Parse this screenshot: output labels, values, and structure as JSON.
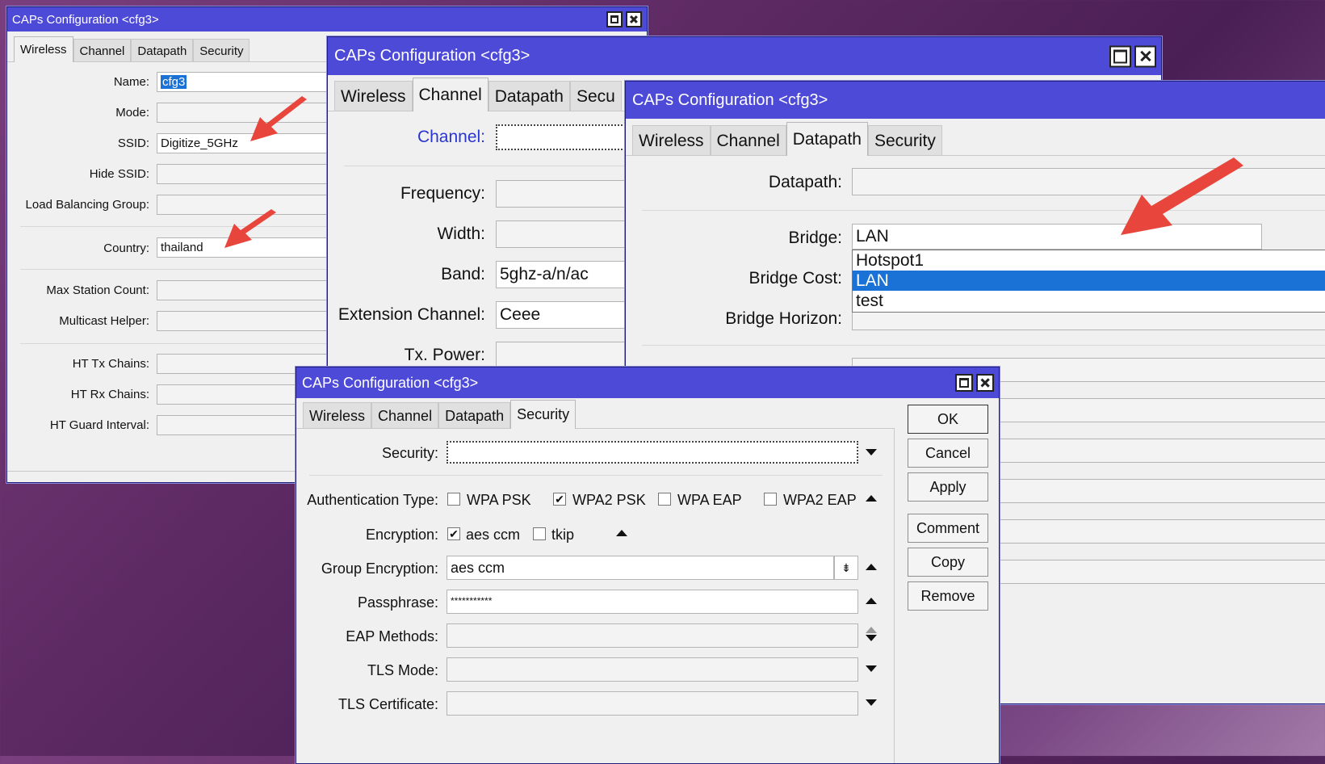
{
  "window_title": "CAPs Configuration <cfg3>",
  "tabs": [
    "Wireless",
    "Channel",
    "Datapath",
    "Security"
  ],
  "tab_truncated": "Secu",
  "wireless": {
    "name_label": "Name:",
    "name_value": "cfg3",
    "mode_label": "Mode:",
    "ssid_label": "SSID:",
    "ssid_value": "Digitize_5GHz",
    "hide_ssid_label": "Hide SSID:",
    "lbg_label": "Load Balancing Group:",
    "country_label": "Country:",
    "country_value": "thailand",
    "max_station_label": "Max Station Count:",
    "multicast_label": "Multicast Helper:",
    "ht_tx_label": "HT Tx Chains:",
    "ht_rx_label": "HT Rx Chains:",
    "ht_guard_label": "HT Guard Interval:"
  },
  "channel": {
    "channel_label": "Channel:",
    "frequency_label": "Frequency:",
    "width_label": "Width:",
    "band_label": "Band:",
    "band_value": "5ghz-a/n/ac",
    "ext_label": "Extension Channel:",
    "ext_value": "Ceee",
    "tx_power_label": "Tx. Power:"
  },
  "datapath": {
    "datapath_label": "Datapath:",
    "bridge_label": "Bridge:",
    "bridge_value": "LAN",
    "bridge_cost_label": "Bridge Cost:",
    "bridge_horizon_label": "Bridge Horizon:",
    "bridge_options": [
      "Hotspot1",
      "LAN",
      "test"
    ],
    "bridge_selected": "LAN"
  },
  "security": {
    "security_label": "Security:",
    "auth_label": "Authentication Type:",
    "auth_options": [
      {
        "label": "WPA PSK",
        "checked": false
      },
      {
        "label": "WPA2 PSK",
        "checked": true
      },
      {
        "label": "WPA EAP",
        "checked": false
      },
      {
        "label": "WPA2 EAP",
        "checked": false
      }
    ],
    "enc_label": "Encryption:",
    "enc_options": [
      {
        "label": "aes ccm",
        "checked": true
      },
      {
        "label": "tkip",
        "checked": false
      }
    ],
    "group_enc_label": "Group Encryption:",
    "group_enc_value": "aes ccm",
    "pass_label": "Passphrase:",
    "pass_value": "***********",
    "eap_label": "EAP Methods:",
    "tls_mode_label": "TLS Mode:",
    "tls_cert_label": "TLS Certificate:"
  },
  "buttons": [
    "OK",
    "Cancel",
    "Apply",
    "Comment",
    "Copy",
    "Remove"
  ],
  "accent": "#4e4ad8",
  "selection": "#1b72d6",
  "annotation": "#e8463c"
}
